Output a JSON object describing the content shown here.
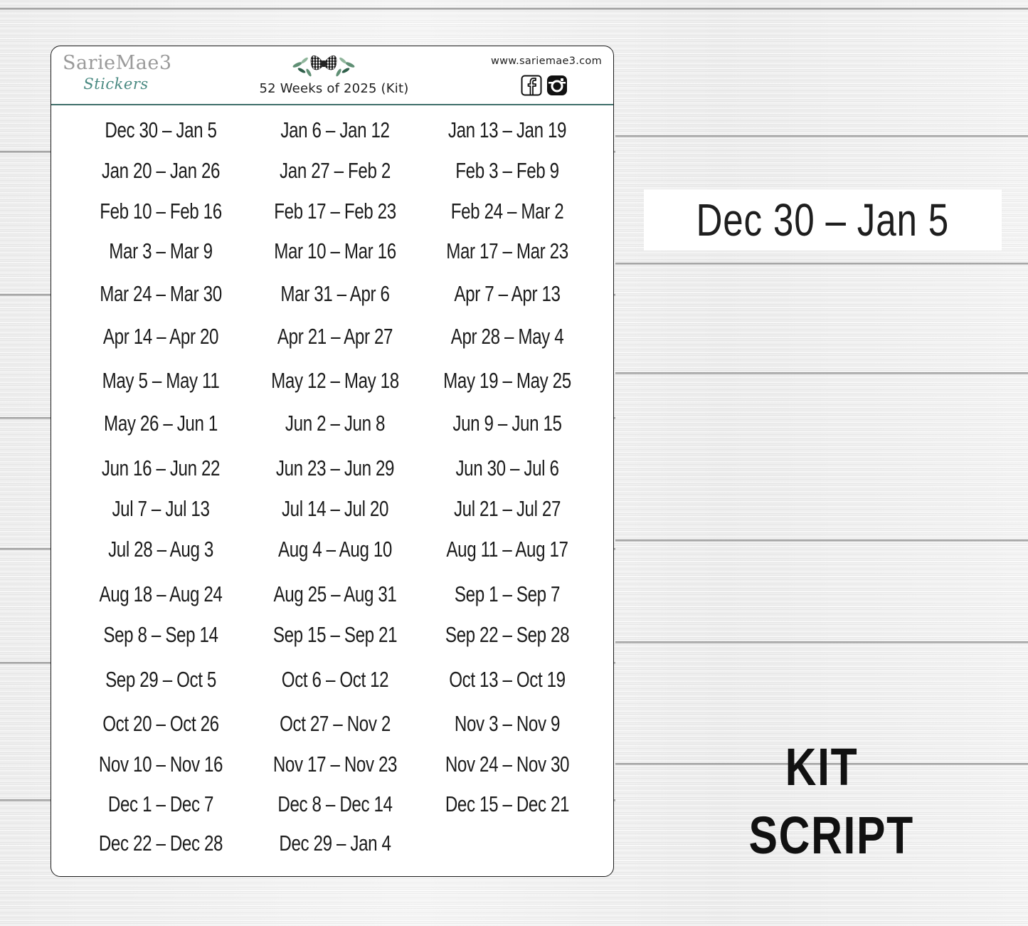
{
  "sheet": {
    "brand": {
      "name": "SarieMae3",
      "sub": "Stickers"
    },
    "ornament_icon": "buffalo-plaid-bow-with-eucalyptus",
    "title": "52 Weeks of 2025 (Kit)",
    "website": "www.sariemae3.com",
    "social_icons": [
      "facebook-icon",
      "instagram-icon"
    ],
    "colors": {
      "accent": "#3f6f6a",
      "brand_gray": "#9a9a9a",
      "brand_teal": "#4a8a82",
      "text": "#1c1c1c"
    },
    "weeks": [
      "Dec 30 – Jan 5",
      "Jan 6 – Jan 12",
      "Jan 13 – Jan 19",
      "Jan 20 – Jan 26",
      "Jan 27 – Feb 2",
      "Feb 3 – Feb 9",
      "Feb 10 – Feb 16",
      "Feb 17 – Feb 23",
      "Feb 24 – Mar 2",
      "Mar 3 – Mar 9",
      "Mar 10 – Mar 16",
      "Mar 17 – Mar 23",
      "Mar 24 – Mar 30",
      "Mar 31 – Apr 6",
      "Apr 7 – Apr 13",
      "Apr 14 – Apr 20",
      "Apr 21 – Apr 27",
      "Apr 28 – May 4",
      "May 5 – May 11",
      "May 12 – May 18",
      "May 19 – May 25",
      "May 26 – Jun 1",
      "Jun 2 – Jun 8",
      "Jun 9 – Jun 15",
      "Jun 16 – Jun 22",
      "Jun 23 – Jun 29",
      "Jun 30 – Jul 6",
      "Jul 7 – Jul 13",
      "Jul 14 – Jul 20",
      "Jul 21 – Jul 27",
      "Jul 28 – Aug 3",
      "Aug 4 – Aug 10",
      "Aug 11 – Aug 17",
      "Aug 18 – Aug 24",
      "Aug 25 – Aug 31",
      "Sep 1 – Sep 7",
      "Sep 8 – Sep 14",
      "Sep 15 – Sep 21",
      "Sep 22 – Sep 28",
      "Sep 29 – Oct 5",
      "Oct 6 – Oct 12",
      "Oct 13 – Oct 19",
      "Oct 20 – Oct 26",
      "Oct 27 – Nov 2",
      "Nov 3 – Nov 9",
      "Nov 10 – Nov 16",
      "Nov 17 – Nov 23",
      "Nov 24 – Nov 30",
      "Dec 1 – Dec 7",
      "Dec 8 – Dec 14",
      "Dec 15 – Dec 21",
      "Dec 22 – Dec 28",
      "Dec 29 – Jan 4"
    ]
  },
  "preview": {
    "sample_label": "Dec 30 – Jan 5",
    "font_caption": {
      "line1": "KIT",
      "line2": "SCRIPT"
    }
  }
}
